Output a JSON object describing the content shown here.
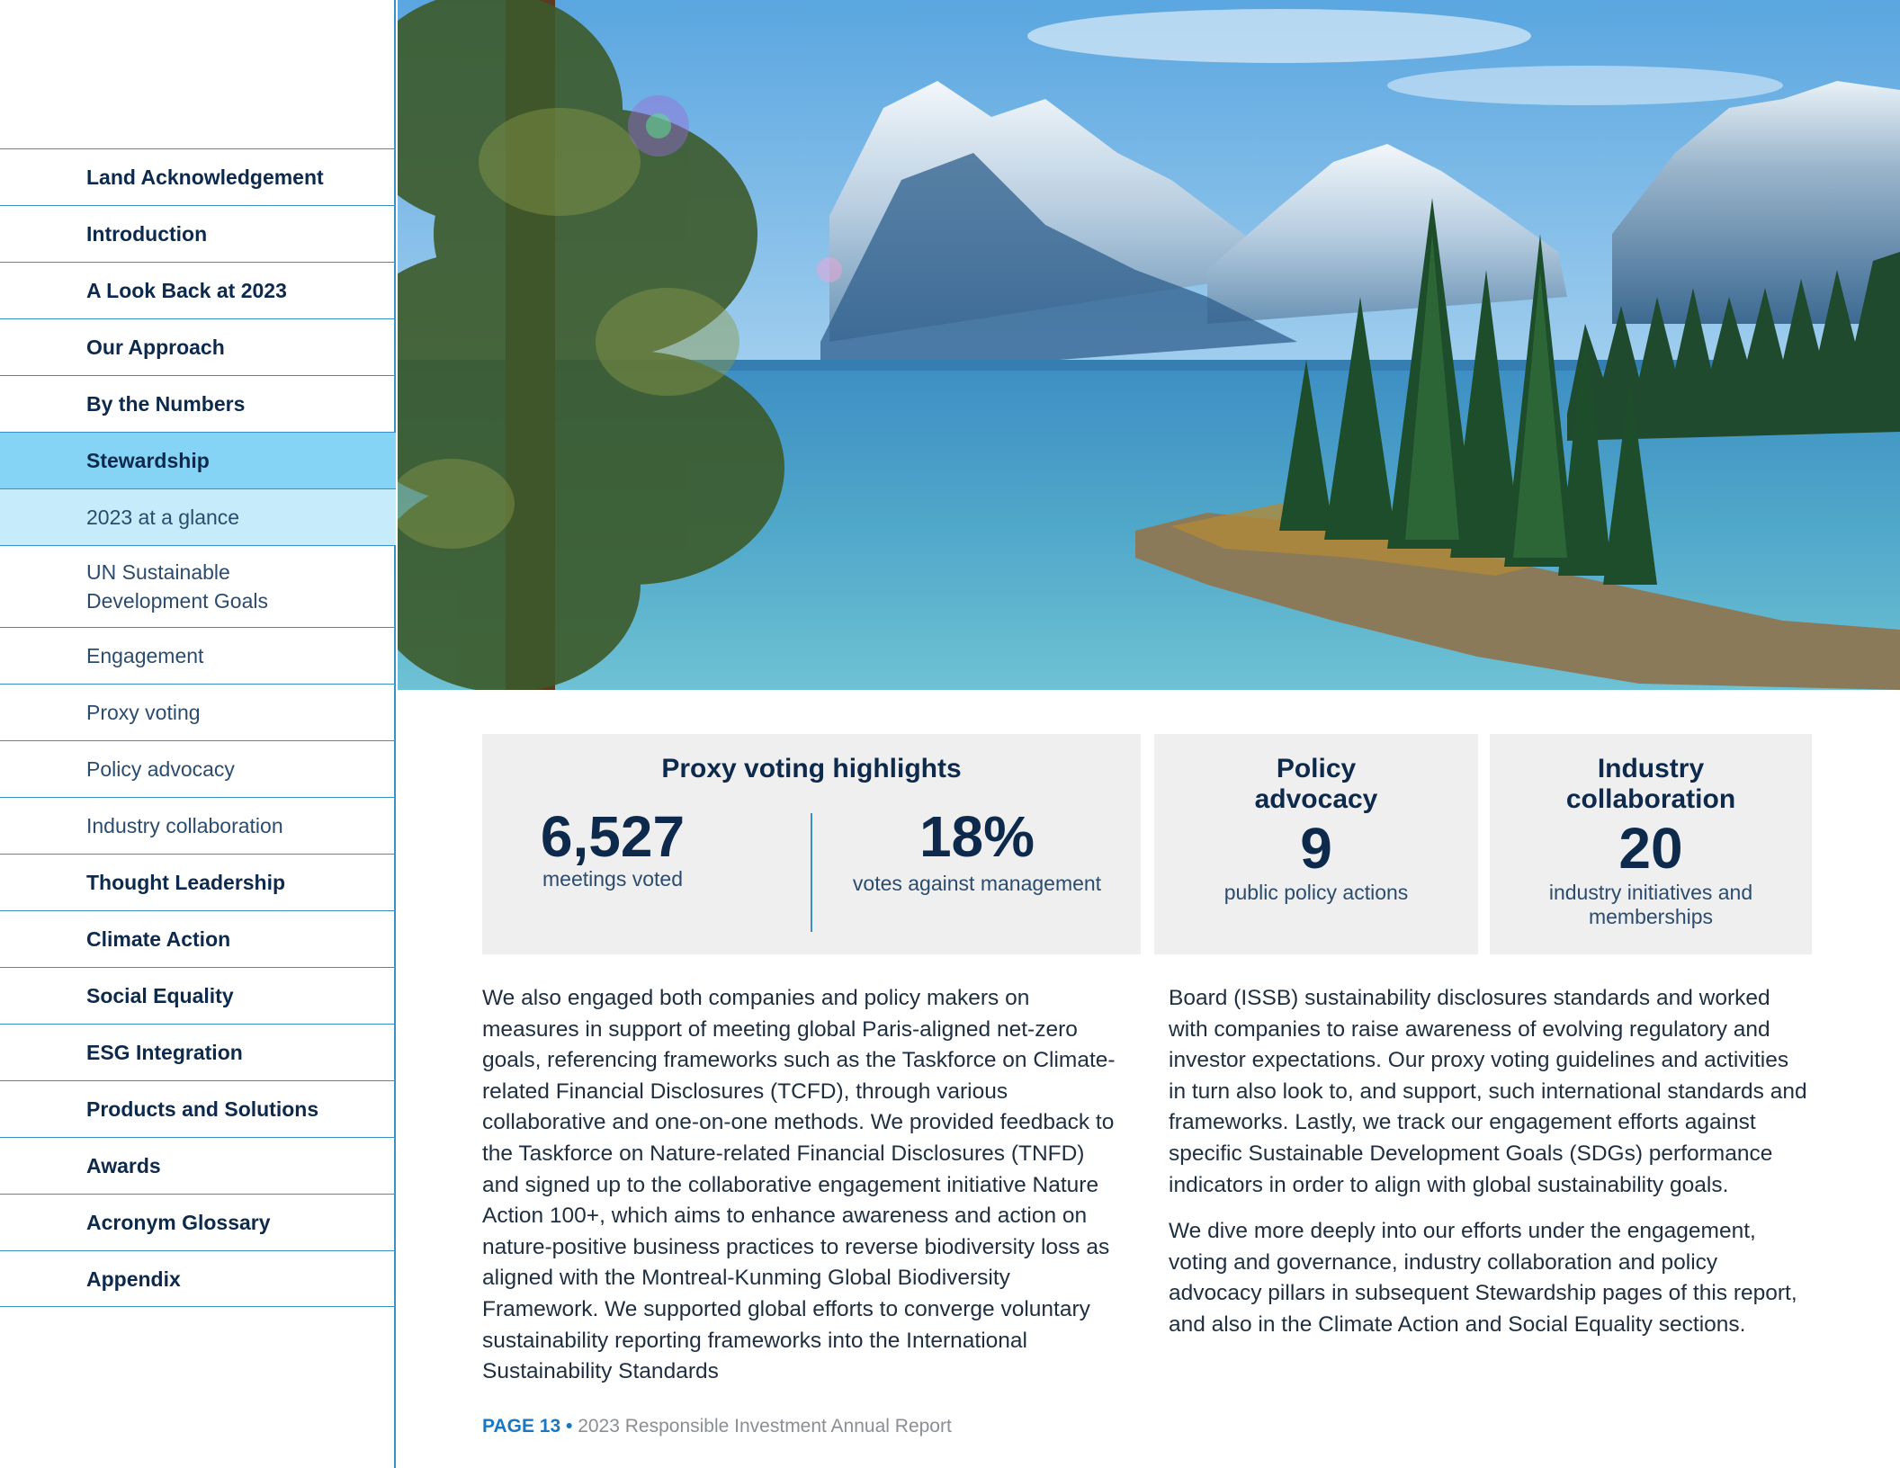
{
  "sidebar": {
    "items": [
      {
        "label": "Land Acknowledgement"
      },
      {
        "label": "Introduction"
      },
      {
        "label": "A Look Back at 2023"
      },
      {
        "label": "Our Approach"
      },
      {
        "label": "By the Numbers"
      },
      {
        "label": "Stewardship"
      },
      {
        "label": "2023 at a glance"
      },
      {
        "label": "UN Sustainable Development Goals"
      },
      {
        "label": "Engagement"
      },
      {
        "label": "Proxy voting"
      },
      {
        "label": "Policy advocacy"
      },
      {
        "label": "Industry collaboration"
      },
      {
        "label": "Thought Leadership"
      },
      {
        "label": "Climate Action"
      },
      {
        "label": "Social Equality"
      },
      {
        "label": "ESG Integration"
      },
      {
        "label": "Products and Solutions"
      },
      {
        "label": "Awards"
      },
      {
        "label": "Acronym Glossary"
      },
      {
        "label": "Appendix"
      }
    ],
    "active_color": "#86d4f5",
    "active_sub_color": "#c6ebfa",
    "border_color": "#3a8fc7"
  },
  "stats": {
    "proxy": {
      "title": "Proxy voting highlights",
      "meetings_value": "6,527",
      "meetings_label": "meetings voted",
      "against_value": "18%",
      "against_label": "votes against management"
    },
    "policy": {
      "title": "Policy advocacy",
      "value": "9",
      "label": "public policy actions"
    },
    "industry": {
      "title": "Industry collaboration",
      "value": "20",
      "label": "industry initiatives and memberships"
    }
  },
  "body": {
    "left": "We also engaged both companies and policy makers on measures in support of meeting global Paris-aligned net-zero goals, referencing frameworks such as the Taskforce on Climate-related Financial Disclosures (TCFD), through various collaborative and one-on-one methods. We provided feedback to the Taskforce on Nature-related Financial Disclosures (TNFD) and signed up to the collaborative engagement initiative Nature Action 100+, which aims to enhance awareness and action on nature-positive business practices to reverse biodiversity loss as aligned with the Montreal-Kunming Global Biodiversity Framework. We supported global efforts to converge voluntary sustainability reporting frameworks into the International Sustainability Standards",
    "right_p1": "Board (ISSB) sustainability disclosures standards and worked with companies to raise awareness of evolving regulatory and investor expectations. Our proxy voting guidelines and activities in turn also look to, and support, such international standards and frameworks. Lastly, we track our engagement efforts against specific Sustainable Development Goals (SDGs) performance indicators in order to align with global sustainability goals.",
    "right_p2": "We dive more deeply into our efforts under the engagement, voting and governance, industry collaboration and policy advocacy pillars in subsequent Stewardship pages of this report, and also in the Climate Action and Social Equality sections."
  },
  "footer": {
    "page": "PAGE 13",
    "separator": "•",
    "report": "2023 Responsible Investment Annual Report"
  },
  "colors": {
    "navy": "#0d2a4d",
    "accent_blue": "#1a78c2",
    "panel_bg": "#efefef"
  }
}
